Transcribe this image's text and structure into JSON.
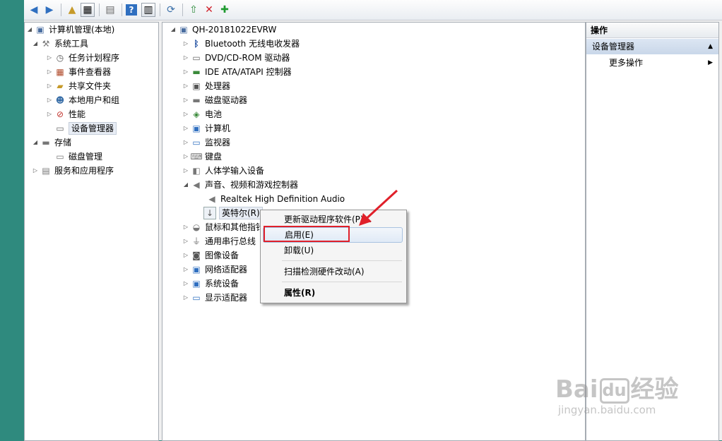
{
  "left_tree": {
    "root": "计算机管理(本地)",
    "system_tools": "系统工具",
    "items": [
      "任务计划程序",
      "事件查看器",
      "共享文件夹",
      "本地用户和组",
      "性能",
      "设备管理器"
    ],
    "storage": "存储",
    "disk_management": "磁盘管理",
    "services": "服务和应用程序"
  },
  "device_tree": {
    "computer_name": "QH-20181022EVRW",
    "categories": [
      "Bluetooth 无线电收发器",
      "DVD/CD-ROM 驱动器",
      "IDE ATA/ATAPI 控制器",
      "处理器",
      "磁盘驱动器",
      "电池",
      "计算机",
      "监视器",
      "键盘",
      "人体学输入设备",
      "声音、视频和游戏控制器"
    ],
    "audio_children": [
      "Realtek High Definition Audio",
      "英特尔(R)"
    ],
    "categories_after": [
      "鼠标和其他指针",
      "通用串行总线",
      "图像设备",
      "网络适配器",
      "系统设备",
      "显示适配器"
    ]
  },
  "actions": {
    "header": "操作",
    "section": "设备管理器",
    "more": "更多操作"
  },
  "context_menu": {
    "update_driver": "更新驱动程序软件(P)...",
    "enable": "启用(E)",
    "uninstall": "卸载(U)",
    "scan": "扫描检测硬件改动(A)",
    "properties": "属性(R)"
  },
  "watermark": {
    "brand": "Bai",
    "brand2": "du",
    "jingyan": "经验",
    "url": "jingyan.baidu.com"
  },
  "colors": {
    "desktop": "#2f8a7e",
    "highlight_box": "#e0202a",
    "arrow": "#e0202a"
  }
}
